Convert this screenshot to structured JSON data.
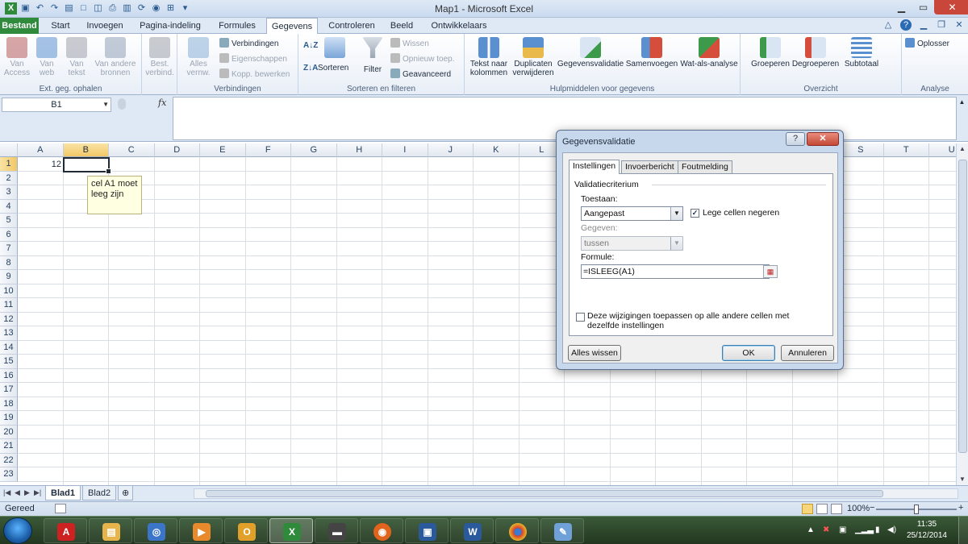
{
  "window": {
    "title": "Map1 - Microsoft Excel",
    "controls": [
      "minimize-button",
      "maximize-button",
      "close-button"
    ]
  },
  "ribbon_tabs": [
    {
      "label": "Bestand",
      "kind": "file"
    },
    {
      "label": "Start"
    },
    {
      "label": "Invoegen"
    },
    {
      "label": "Pagina-indeling"
    },
    {
      "label": "Formules"
    },
    {
      "label": "Gegevens",
      "active": true
    },
    {
      "label": "Controleren"
    },
    {
      "label": "Beeld"
    },
    {
      "label": "Ontwikkelaars"
    }
  ],
  "ribbon": {
    "ext_data": {
      "access": "Van Access",
      "web": "Van web",
      "text": "Van tekst",
      "other": "Van andere bronnen",
      "existing": "Best. verbind.",
      "label": "Ext. geg. ophalen"
    },
    "connections": {
      "refresh_all": "Alles vernw.",
      "connections": "Verbindingen",
      "properties": "Eigenschappen",
      "edit_links": "Kopp. bewerken",
      "label": "Verbindingen"
    },
    "sort_filter": {
      "sort": "Sorteren",
      "filter": "Filter",
      "clear": "Wissen",
      "reapply": "Opnieuw toep.",
      "advanced": "Geavanceerd",
      "label": "Sorteren en filteren"
    },
    "data_tools": {
      "text_to_columns": "Tekst naar kolommen",
      "remove_duplicates": "Duplicaten verwijderen",
      "data_validation": "Gegevensvalidatie",
      "consolidate": "Samenvoegen",
      "what_if": "Wat-als-analyse",
      "label": "Hulpmiddelen voor gegevens"
    },
    "outline": {
      "group": "Groeperen",
      "ungroup": "Degroeperen",
      "subtotal": "Subtotaal",
      "label": "Overzicht"
    },
    "analysis": {
      "solver": "Oplosser",
      "label": "Analyse"
    }
  },
  "formula_bar": {
    "name_box": "B1",
    "fx_label": "fx",
    "formula": ""
  },
  "grid": {
    "columns": [
      "A",
      "B",
      "C",
      "D",
      "E",
      "F",
      "G",
      "H",
      "I",
      "J",
      "K",
      "L",
      "M",
      "N",
      "O",
      "P",
      "Q",
      "R",
      "S",
      "T",
      "U"
    ],
    "rows": [
      "1",
      "2",
      "3",
      "4",
      "5",
      "6",
      "7",
      "8",
      "9",
      "10",
      "11",
      "12",
      "13",
      "14",
      "15",
      "16",
      "17",
      "18",
      "19",
      "20",
      "21",
      "22",
      "23"
    ],
    "selected_cell": "B1",
    "cells": {
      "A1": "12"
    },
    "input_message": "cel A1 moet leeg zijn"
  },
  "sheets": {
    "tabs": [
      "Blad1",
      "Blad2"
    ],
    "active": "Blad1"
  },
  "status": {
    "ready": "Gereed",
    "zoom": "100%",
    "zoom_value": 100
  },
  "dialog": {
    "title": "Gegevensvalidatie",
    "tabs": [
      "Instellingen",
      "Invoerbericht",
      "Foutmelding"
    ],
    "active_tab": "Instellingen",
    "section": "Validatiecriterium",
    "allow_label": "Toestaan:",
    "allow_value": "Aangepast",
    "ignore_blank_label": "Lege cellen negeren",
    "ignore_blank_checked": true,
    "data_label": "Gegeven:",
    "data_value": "tussen",
    "formula_label": "Formule:",
    "formula_value": "=ISLEEG(A1)",
    "apply_all_label": "Deze wijzigingen toepassen op alle andere cellen met dezelfde instellingen",
    "apply_all_checked": false,
    "clear_all": "Alles wissen",
    "ok": "OK",
    "cancel": "Annuleren",
    "help": "?"
  },
  "taskbar": {
    "apps": [
      "start-orb",
      "acrobat-icon",
      "explorer-icon",
      "network-icon",
      "media-player-icon",
      "outlook-icon",
      "excel-icon",
      "device-icon",
      "firefox-icon",
      "virtualbox-icon",
      "word-icon",
      "chrome-icon",
      "paint-icon"
    ],
    "time": "11:35",
    "date": "25/12/2014"
  },
  "colors": {
    "file_tab": "#2f8a3c",
    "accent": "#2a5a8f",
    "selection_header": "#f2c866",
    "dialog_frame": "#c8d8ec"
  }
}
